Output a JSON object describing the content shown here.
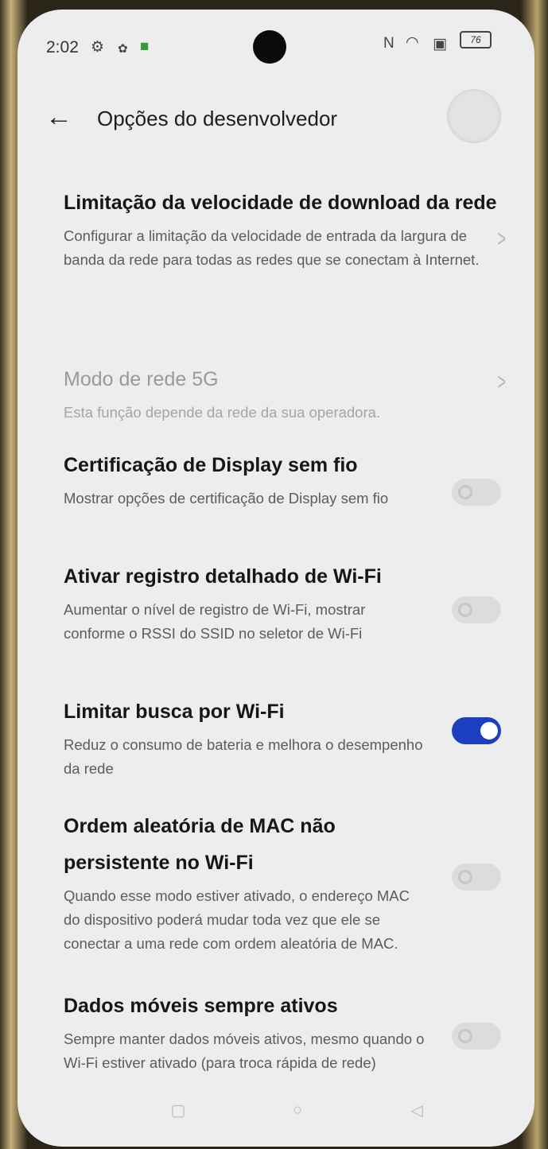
{
  "status_bar": {
    "time": "2:02",
    "left_icons": [
      "settings-gear-icon",
      "bug-icon",
      "android-app-icon"
    ],
    "right_icons": [
      "nfc-icon",
      "wifi-icon",
      "no-sim-icon"
    ],
    "battery": "76"
  },
  "header": {
    "title": "Opções do desenvolvedor"
  },
  "settings": [
    {
      "title": "Limitação da velocidade de download da rede",
      "description": "Configurar a limitação da velocidade de entrada da largura de banda da rede para todas as redes que se conectam à Internet.",
      "control": "chevron"
    },
    {
      "title": "Modo de rede 5G",
      "description": "Esta função depende da rede da sua operadora.",
      "control": "chevron",
      "disabled": true
    },
    {
      "title": "Certificação de Display sem fio",
      "description": "Mostrar opções de certificação de Display sem fio",
      "control": "toggle",
      "on": false
    },
    {
      "title": "Ativar registro detalhado de Wi-Fi",
      "description": "Aumentar o nível de registro de Wi-Fi, mostrar conforme o RSSI do SSID no seletor de Wi-Fi",
      "control": "toggle",
      "on": false
    },
    {
      "title": "Limitar busca por Wi-Fi",
      "description": "Reduz o consumo de bateria e melhora o desempenho da rede",
      "control": "toggle",
      "on": true
    },
    {
      "title": "Ordem aleatória de MAC não persistente no Wi-Fi",
      "description": "Quando esse modo estiver ativado, o endereço MAC do dispositivo poderá mudar toda vez que ele se conectar a uma rede com ordem aleatória de MAC.",
      "control": "toggle",
      "on": false
    },
    {
      "title": "Dados móveis sempre ativos",
      "description": "Sempre manter dados móveis ativos, mesmo quando o Wi-Fi estiver ativado (para troca rápida de rede)",
      "control": "toggle",
      "on": false
    }
  ],
  "colors": {
    "toggle_on": "#1c3fbf",
    "background": "#ededed"
  }
}
